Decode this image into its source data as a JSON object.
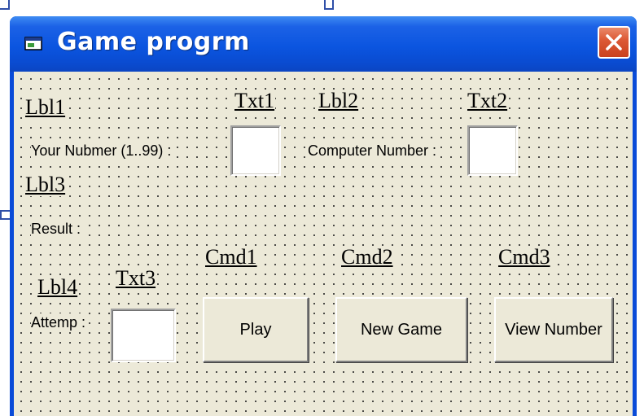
{
  "window": {
    "title": "Game progrm"
  },
  "labels": {
    "lbl1": "Lbl1",
    "txt1": "Txt1",
    "lbl2": "Lbl2",
    "txt2": "Txt2",
    "lbl3": "Lbl3",
    "lbl4": "Lbl4",
    "txt3": "Txt3",
    "cmd1": "Cmd1",
    "cmd2": "Cmd2",
    "cmd3": "Cmd3"
  },
  "captions": {
    "your_number": "Your Nubmer (1..99) :",
    "computer_number": "Computer Number :",
    "result": "Result :",
    "attemp": "Attemp :"
  },
  "inputs": {
    "txt1_value": "",
    "txt2_value": "",
    "txt3_value": ""
  },
  "buttons": {
    "play": "Play",
    "new_game": "New Game",
    "view_number": "View Number"
  },
  "icons": {
    "window_icon": "form-icon",
    "close": "close-icon"
  },
  "colors": {
    "titlebar": "#0a4bd8",
    "form_background": "#ece9d8",
    "close_button": "#dd5a36"
  }
}
